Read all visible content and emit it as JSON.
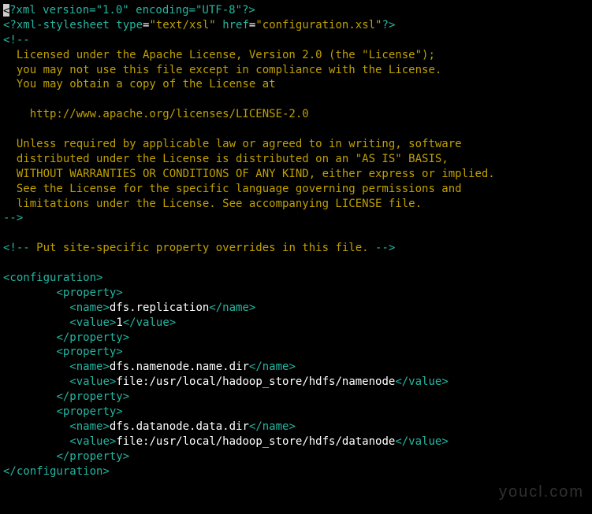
{
  "xml": {
    "prolog": "<?xml version=\"1.0\" encoding=\"UTF-8\"?>",
    "stylesheet_pi": "<?xml-stylesheet",
    "stylesheet_attr_type_name": "type",
    "stylesheet_attr_type_val": "\"text/xsl\"",
    "stylesheet_attr_href_name": "href",
    "stylesheet_attr_href_val": "\"configuration.xsl\"",
    "stylesheet_close": "?>",
    "license_open": "<!--",
    "license_lines": [
      "  Licensed under the Apache License, Version 2.0 (the \"License\");",
      "  you may not use this file except in compliance with the License.",
      "  You may obtain a copy of the License at",
      "",
      "    http://www.apache.org/licenses/LICENSE-2.0",
      "",
      "  Unless required by applicable law or agreed to in writing, software",
      "  distributed under the License is distributed on an \"AS IS\" BASIS,",
      "  WITHOUT WARRANTIES OR CONDITIONS OF ANY KIND, either express or implied.",
      "  See the License for the specific language governing permissions and",
      "  limitations under the License. See accompanying LICENSE file."
    ],
    "license_close": "-->",
    "site_comment_open": "<!--",
    "site_comment_text": " Put site-specific property overrides in this file. ",
    "site_comment_close": "-->",
    "root_open": "<configuration>",
    "root_close": "</configuration>",
    "tags": {
      "property_open": "<property>",
      "property_close": "</property>",
      "name_open": "<name>",
      "name_close": "</name>",
      "value_open": "<value>",
      "value_close": "</value>"
    },
    "properties": [
      {
        "name": "dfs.replication",
        "value": "1"
      },
      {
        "name": "dfs.namenode.name.dir",
        "value": "file:/usr/local/hadoop_store/hdfs/namenode"
      },
      {
        "name": "dfs.datanode.data.dir",
        "value": "file:/usr/local/hadoop_store/hdfs/datanode"
      }
    ]
  },
  "watermark": "youcl.com"
}
